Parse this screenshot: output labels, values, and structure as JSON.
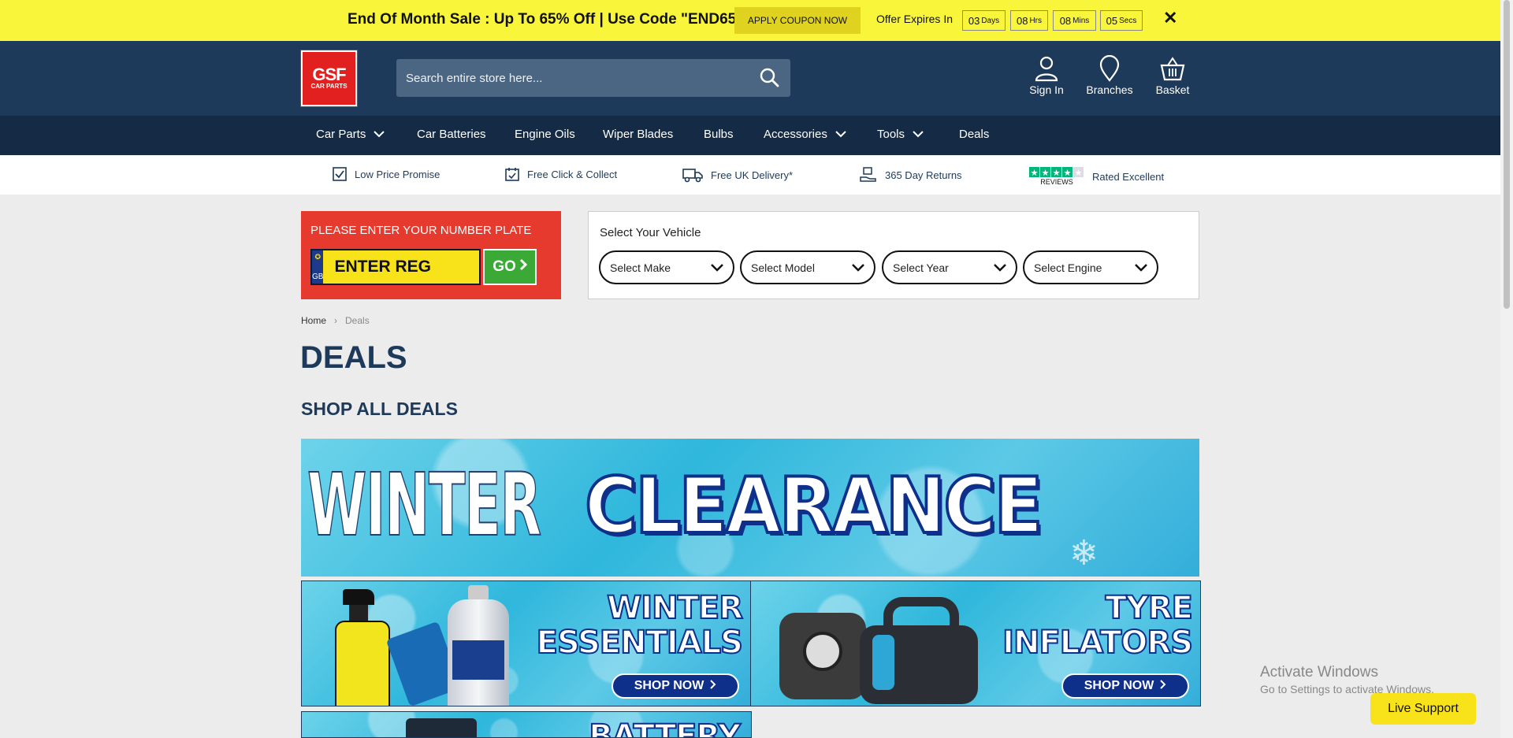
{
  "promo": {
    "text": "End Of Month Sale : Up To 65% Off | Use Code \"END65\"",
    "coupon_button": "APPLY COUPON NOW",
    "expires_label": "Offer Expires In",
    "countdown": [
      {
        "value": "03",
        "unit": "Days"
      },
      {
        "value": "08",
        "unit": "Hrs"
      },
      {
        "value": "08",
        "unit": "Mins"
      },
      {
        "value": "05",
        "unit": "Secs"
      }
    ],
    "close": "✕"
  },
  "header": {
    "logo_main": "GSF",
    "logo_sub": "CAR PARTS",
    "search_placeholder": "Search entire store here...",
    "sign_in": "Sign In",
    "branches": "Branches",
    "basket": "Basket"
  },
  "nav": {
    "items": [
      {
        "label": "Car Parts",
        "dropdown": true
      },
      {
        "label": "Car Batteries",
        "dropdown": false
      },
      {
        "label": "Engine Oils",
        "dropdown": false
      },
      {
        "label": "Wiper Blades",
        "dropdown": false
      },
      {
        "label": "Bulbs",
        "dropdown": false
      },
      {
        "label": "Accessories",
        "dropdown": true
      },
      {
        "label": "Tools",
        "dropdown": true
      },
      {
        "label": "Deals",
        "dropdown": false
      }
    ]
  },
  "usp": {
    "items": [
      {
        "label": "Low Price Promise",
        "icon": "checkbox-icon"
      },
      {
        "label": "Free Click & Collect",
        "icon": "calendar-check-icon"
      },
      {
        "label": "Free UK Delivery*",
        "icon": "truck-icon"
      },
      {
        "label": "365 Day Returns",
        "icon": "return-hand-icon"
      },
      {
        "label": "Rated Excellent",
        "icon": "reviews-stars-icon"
      }
    ],
    "reviews_text": "REVIEWS"
  },
  "reg": {
    "title": "PLEASE ENTER YOUR NUMBER PLATE",
    "country": "GB",
    "placeholder": "ENTER REG",
    "go": "GO"
  },
  "vehicle": {
    "title": "Select Your Vehicle",
    "selects": [
      "Select Make",
      "Select Model",
      "Select Year",
      "Select Engine"
    ]
  },
  "breadcrumb": {
    "home": "Home",
    "separator": "›",
    "current": "Deals"
  },
  "page": {
    "title": "DEALS",
    "subtitle": "SHOP ALL DEALS"
  },
  "banners": {
    "hero_word1": "WINTER",
    "hero_word2": "CLEARANCE",
    "tile1_line1": "WINTER",
    "tile1_line2": "ESSENTIALS",
    "tile2_line1": "TYRE",
    "tile2_line2": "INFLATORS",
    "shop_now": "SHOP NOW",
    "tile3_title": "BATTERY"
  },
  "watermark": {
    "line1": "Activate Windows",
    "line2": "Go to Settings to activate Windows."
  },
  "live_support": "Live Support",
  "colors": {
    "promo_bg": "#f8f53a",
    "header_bg": "#1e3a5a",
    "nav_bg": "#152a45",
    "reg_bg": "#e73a2f",
    "go_green": "#3aa935",
    "plate_yellow": "#f8e21a"
  }
}
